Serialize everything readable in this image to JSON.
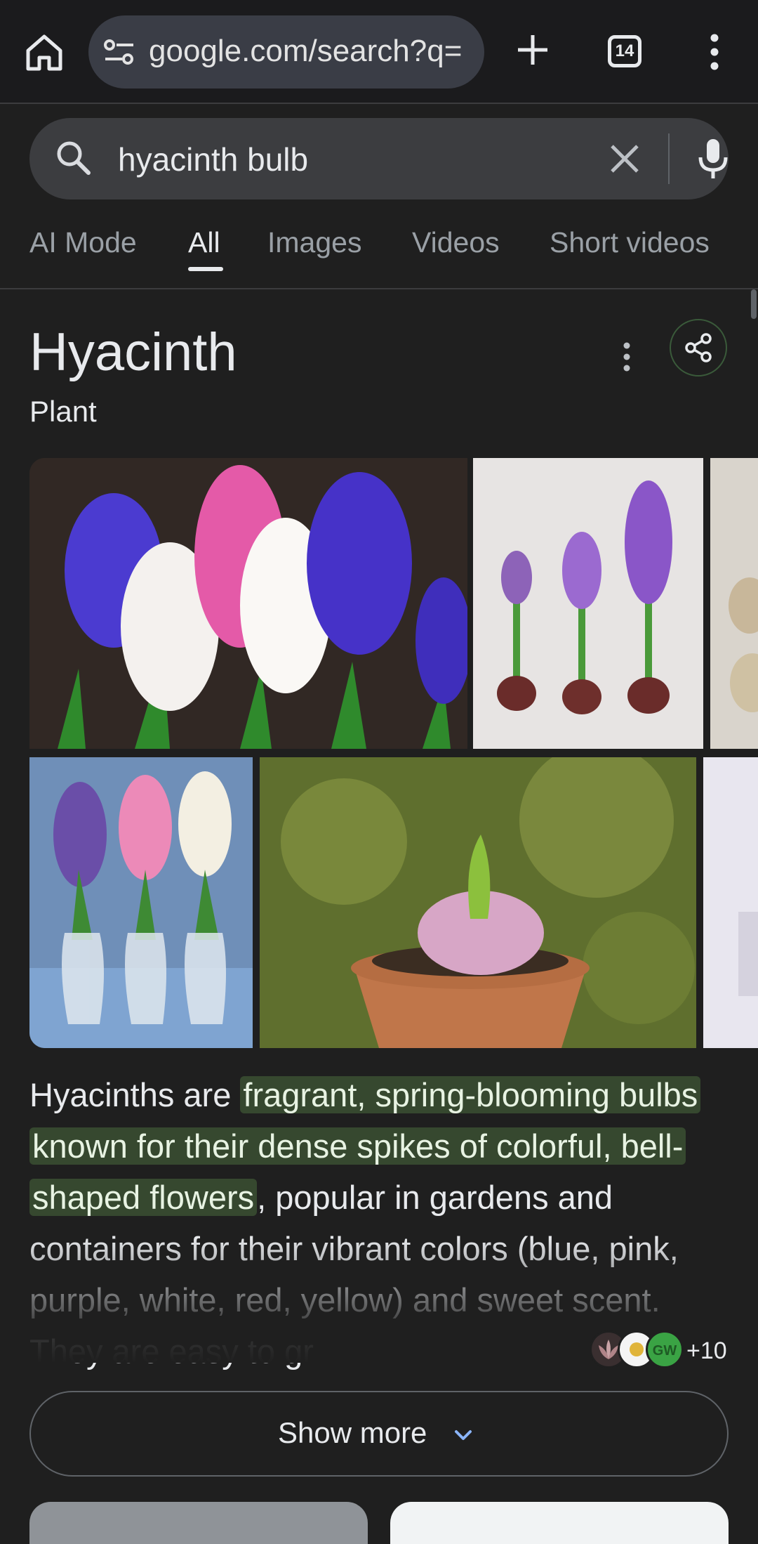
{
  "browser": {
    "url": "google.com/search?q=",
    "tab_count": "14"
  },
  "search": {
    "query": "hyacinth bulb"
  },
  "filters": {
    "tabs": [
      "AI Mode",
      "All",
      "Images",
      "Videos",
      "Short videos"
    ],
    "active": "All"
  },
  "knowledge_panel": {
    "title": "Hyacinth",
    "subtitle": "Plant",
    "description_plain_1": "Hyacinths are ",
    "description_highlight": "fragrant, spring-blooming bulbs known for their dense spikes of colorful, bell-shaped flowers",
    "description_plain_2": ", popular in gardens and containers for their vibrant colors (blue, pink, purple, white, red, yellow) and sweet scent. They are easy to gr",
    "sources_more": "+10",
    "show_more_label": "Show more"
  },
  "colors": {
    "background": "#1f1f1f",
    "highlight": "#36482f",
    "accent_green": "#3a5a3a"
  },
  "icons": [
    "home-icon",
    "tune-icon",
    "plus-icon",
    "tabs-icon",
    "more-vert-icon",
    "search-icon",
    "close-icon",
    "mic-icon",
    "share-icon",
    "chevron-down-icon"
  ]
}
